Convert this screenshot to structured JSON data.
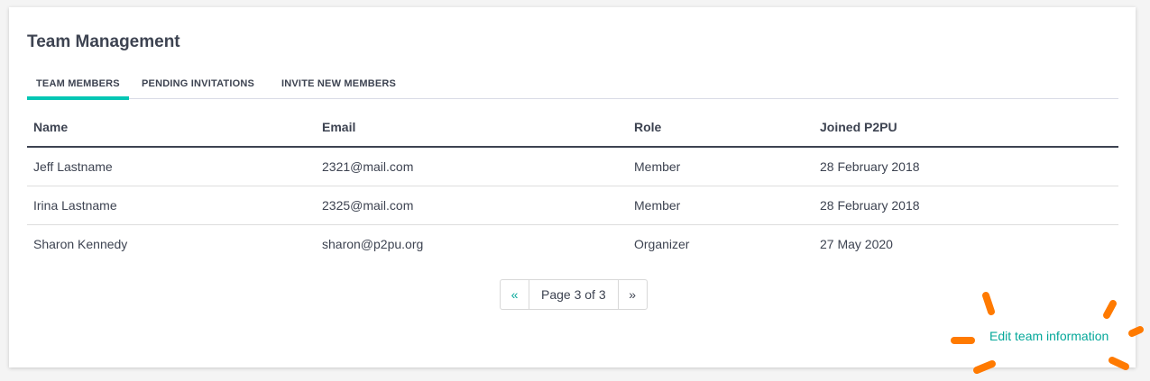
{
  "title": "Team Management",
  "tabs": [
    {
      "label": "TEAM MEMBERS"
    },
    {
      "label": "PENDING INVITATIONS"
    },
    {
      "label": "INVITE NEW MEMBERS"
    }
  ],
  "table": {
    "headers": [
      "Name",
      "Email",
      "Role",
      "Joined P2PU"
    ],
    "rows": [
      [
        "Jeff Lastname",
        "2321@mail.com",
        "Member",
        "28 February 2018"
      ],
      [
        "Irina Lastname",
        "2325@mail.com",
        "Member",
        "28 February 2018"
      ],
      [
        "Sharon Kennedy",
        "sharon@p2pu.org",
        "Organizer",
        "27 May 2020"
      ]
    ]
  },
  "pagination": {
    "prev": "«",
    "label": "Page 3 of 3",
    "next": "»"
  },
  "edit_link": "Edit team information",
  "colors": {
    "accent": "#05c6b4",
    "link": "#05a89a",
    "highlight_marks": "#ff7a00"
  },
  "icons": [
    "highlight-marks"
  ]
}
